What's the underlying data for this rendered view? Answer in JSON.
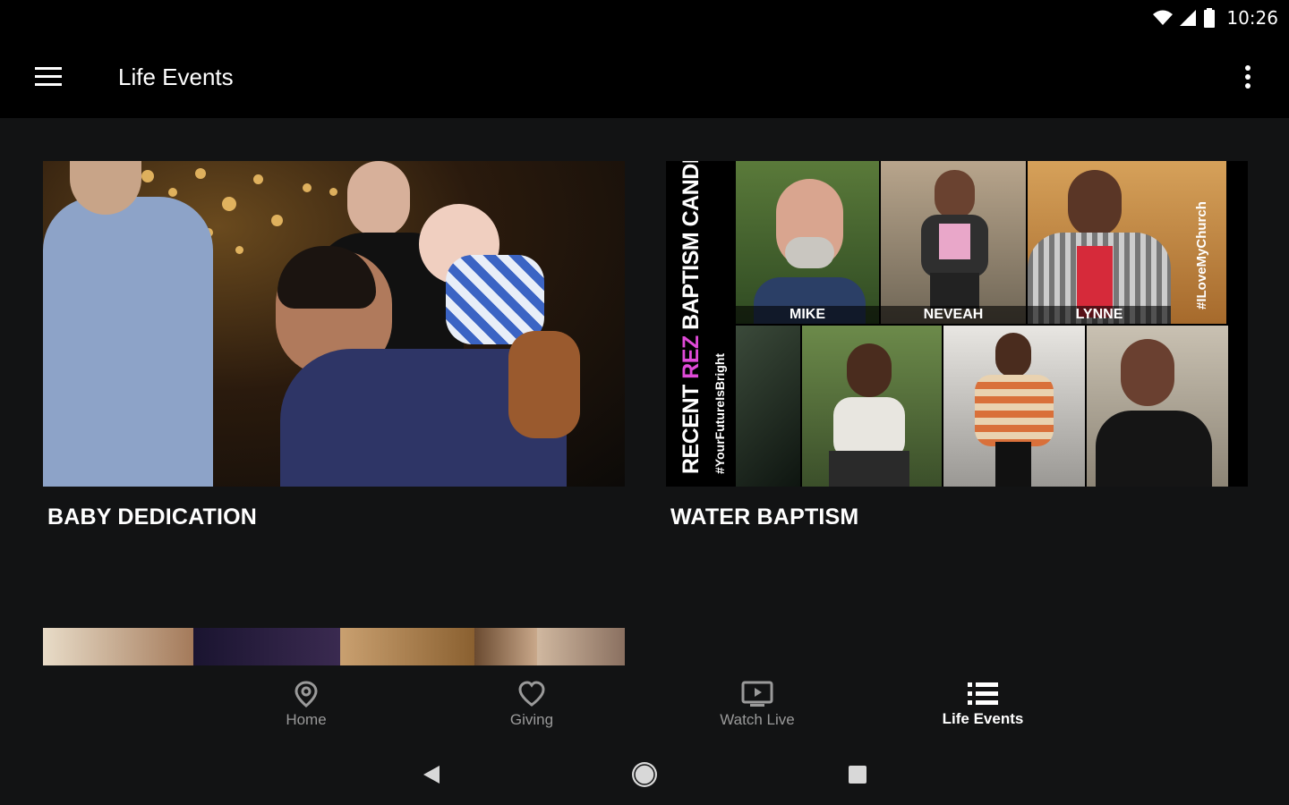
{
  "status": {
    "time": "10:26"
  },
  "app_bar": {
    "title": "Life Events"
  },
  "cards": [
    {
      "title": "BABY DEDICATION"
    },
    {
      "title": "WATER BAPTISM",
      "collage": {
        "prefix": "RECENT ",
        "highlight": "REZ",
        "suffix": " BAPTISM CANDIDATES",
        "hashtag_left": "#YourFutureIsBright",
        "hashtag_right": "#ILoveMyChurch",
        "names": [
          "MIKE",
          "NEVEAH",
          "LYNNE"
        ],
        "accent": "#e04ad8"
      }
    }
  ],
  "bottom_nav": [
    {
      "label": "Home",
      "icon": "location-pin-icon"
    },
    {
      "label": "Giving",
      "icon": "heart-icon"
    },
    {
      "label": "Watch Live",
      "icon": "tv-play-icon"
    },
    {
      "label": "Life Events",
      "icon": "list-icon",
      "active": true
    }
  ]
}
